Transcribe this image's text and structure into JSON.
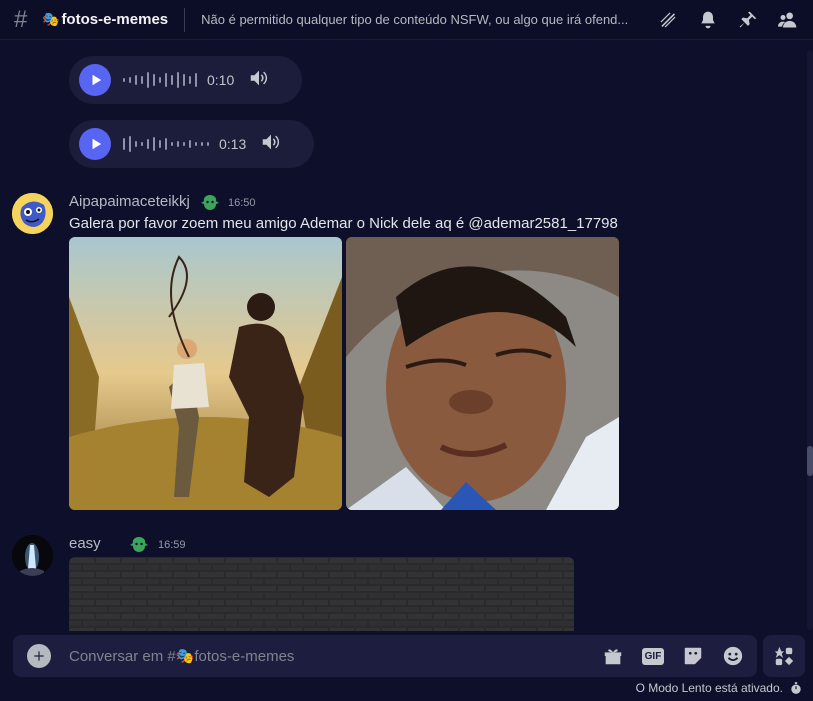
{
  "header": {
    "channel_emoji": "🎭",
    "channel_name": "fotos-e-memes",
    "topic": "Não é permitido qualquer tipo de conteúdo NSFW, ou algo que irá ofend..."
  },
  "voice_messages": [
    {
      "duration": "0:10"
    },
    {
      "duration": "0:13"
    }
  ],
  "messages": [
    {
      "username": "Aipapaimaceteikkj",
      "time": "16:50",
      "text": "Galera por favor zoem meu amigo Ademar o Nick dele aq é @ademar2581_17798"
    },
    {
      "username": "easy",
      "time": "16:59"
    }
  ],
  "composer": {
    "placeholder": "Conversar em #🎭fotos-e-memes",
    "gif_label": "GIF"
  },
  "footer": {
    "slow_mode": "O Modo Lento está ativado."
  },
  "colors": {
    "accent": "#5865f2",
    "background": "#0e0f2b",
    "badge": "#3ba55c"
  }
}
